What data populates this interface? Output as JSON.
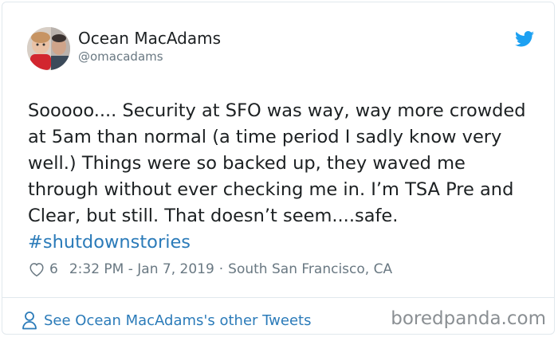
{
  "tweet": {
    "author_name": "Ocean MacAdams",
    "author_handle": "@omacadams",
    "text": "Sooooo.... Security at SFO was way, way more crowded at 5am than normal (a time period I sadly know very well.) Things were so backed up, they waved me through without ever checking me in. I’m TSA Pre and Clear, but still. That doesn’t seem....safe. ",
    "hashtag": "#shutdownstories",
    "likes": "6",
    "timestamp": "2:32 PM - Jan 7, 2019",
    "separator": "·",
    "location": "South San Francisco, CA",
    "footer_link": "See Ocean MacAdams's other Tweets"
  },
  "watermark": "boredpanda.com",
  "colors": {
    "link": "#2b7bb9",
    "twitter_blue": "#1da1f2",
    "secondary_text": "#697882",
    "border": "#e1e8ed"
  },
  "icons": {
    "brand": "twitter-bird-icon",
    "like": "heart-icon",
    "profile": "person-icon"
  }
}
